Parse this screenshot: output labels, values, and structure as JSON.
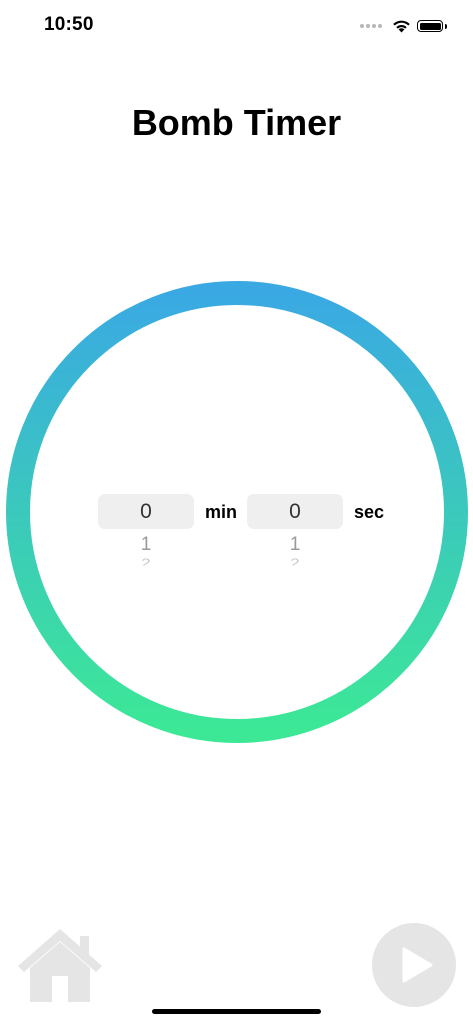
{
  "status_bar": {
    "time": "10:50",
    "icons": [
      "signal-dots-icon",
      "wifi-icon",
      "battery-icon"
    ]
  },
  "title": "Bomb Timer",
  "ring": {
    "gradient_top": "#3aa9e3",
    "gradient_bottom": "#3ce896"
  },
  "timer": {
    "minutes": {
      "selected": "0",
      "next": "1",
      "after": "2",
      "unit": "min"
    },
    "seconds": {
      "selected": "0",
      "next": "1",
      "after": "2",
      "unit": "sec"
    }
  },
  "controls": {
    "home_icon": "home-icon",
    "play_icon": "play-icon",
    "button_color": "#e5e5e5"
  }
}
